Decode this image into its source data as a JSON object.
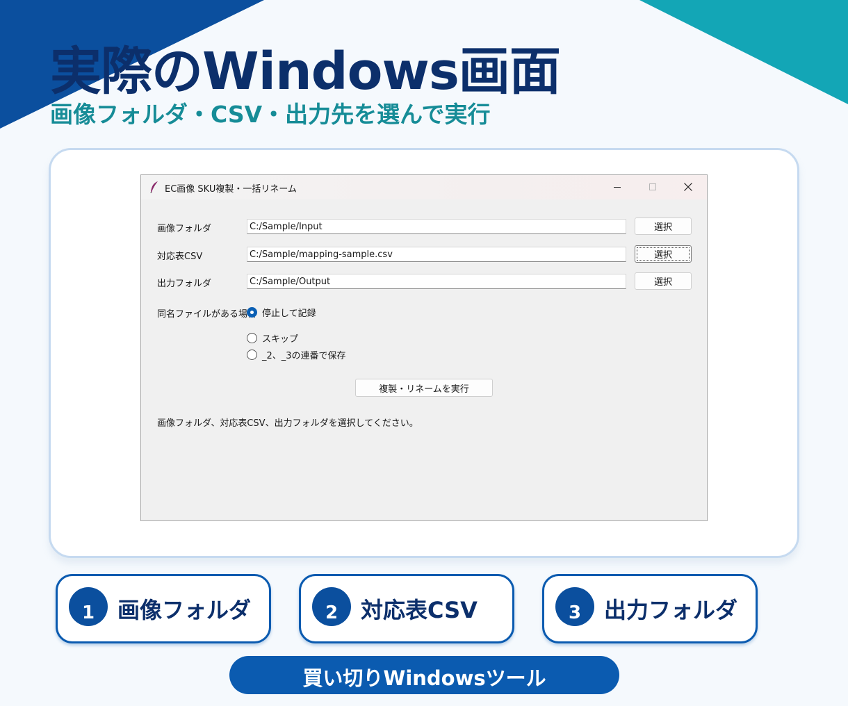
{
  "hero": {
    "title": "実際のWindows画面",
    "subtitle": "画像フォルダ・CSV・出力先を選んで実行"
  },
  "window": {
    "title": "EC画像 SKU複製・一括リネーム",
    "icon": "feather-icon",
    "fields": [
      {
        "label": "画像フォルダ",
        "value": "C:/Sample/Input",
        "button": "選択"
      },
      {
        "label": "対応表CSV",
        "value": "C:/Sample/mapping-sample.csv",
        "button": "選択"
      },
      {
        "label": "出力フォルダ",
        "value": "C:/Sample/Output",
        "button": "選択"
      }
    ],
    "conflict": {
      "label": "同名ファイルがある場合",
      "options": [
        "停止して記録",
        "スキップ",
        "_2、_3の連番で保存"
      ],
      "selected": "停止して記録"
    },
    "run_button": "複製・リネームを実行",
    "status": "画像フォルダ、対応表CSV、出力フォルダを選択してください。"
  },
  "steps": [
    {
      "number": "1",
      "label": "画像フォルダ"
    },
    {
      "number": "2",
      "label": "対応表CSV"
    },
    {
      "number": "3",
      "label": "出力フォルダ"
    }
  ],
  "footer_pill": "買い切りWindowsツール",
  "colors": {
    "navy": "#0c2f6b",
    "brand_blue": "#0b5bb0",
    "teal": "#13a6b6",
    "radio_selected": "#0a5fb4"
  }
}
